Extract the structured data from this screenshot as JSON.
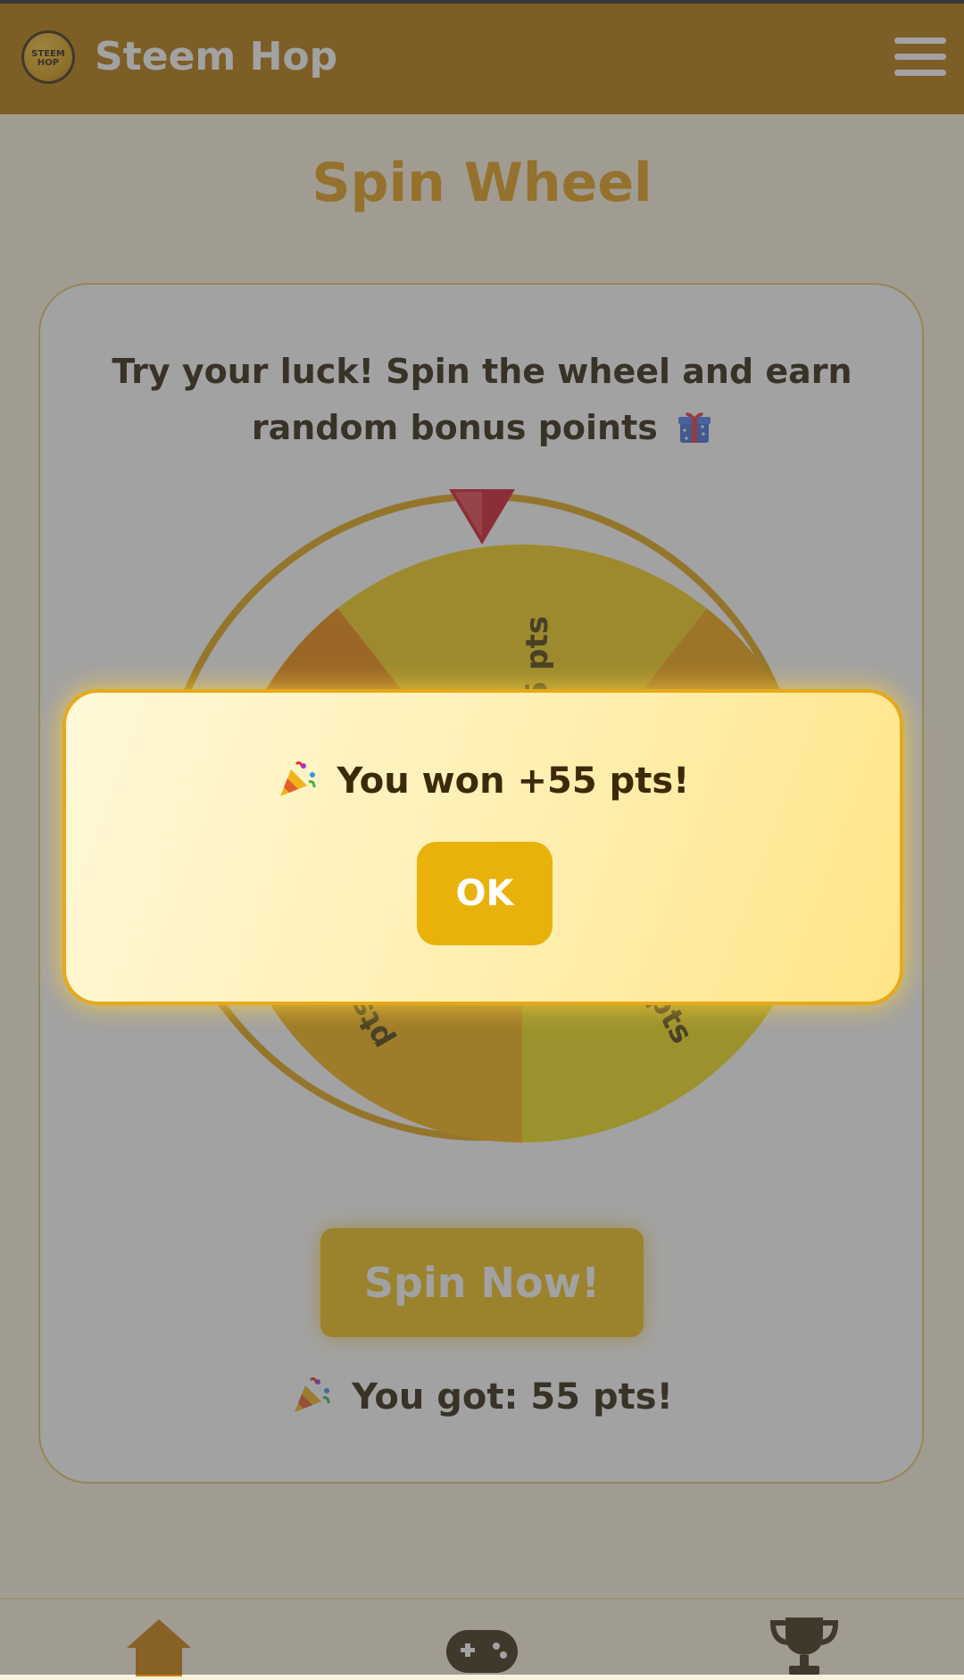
{
  "header": {
    "logo_text": "STEEM HOP",
    "brand": "Steem Hop",
    "menu_icon": "hamburger-menu-icon"
  },
  "page": {
    "title": "Spin Wheel",
    "intro": "Try your luck! Spin the wheel and earn random bonus points",
    "intro_icon": "gift-icon"
  },
  "wheel": {
    "segment_labels": [
      "55 pts",
      "pts",
      "pts"
    ],
    "colors": {
      "ring": "#e3a513",
      "pointer": "#d3172a",
      "segment_dark_orange": "#ef8a07",
      "segment_orange": "#f5a50c",
      "segment_gold": "#f6c30f",
      "segment_yellow": "#f5dc12"
    }
  },
  "actions": {
    "spin_label": "Spin Now!",
    "result_text": "You got: 55 pts!",
    "result_icon": "party-popper-icon"
  },
  "modal": {
    "message": "You won +55 pts!",
    "message_icon": "party-popper-icon",
    "ok_label": "OK"
  },
  "bottom_nav": {
    "items": [
      "home-icon",
      "gamepad-icon",
      "trophy-icon"
    ],
    "accent": "#c87d06"
  }
}
